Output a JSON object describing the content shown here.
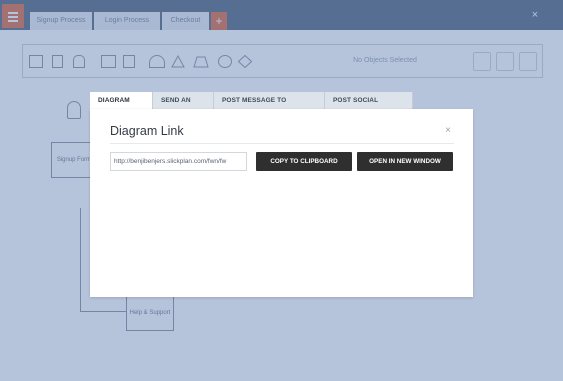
{
  "app": {
    "tabs": [
      "Signup Process",
      "Login Process",
      "Checkout"
    ],
    "add_tab_label": "+",
    "close_label": "×",
    "toolbar_search_label": "No Objects Selected",
    "nodes": {
      "signup_form": "Signup Form",
      "help_support": "Help & Support"
    }
  },
  "modal": {
    "tabs": [
      "DIAGRAM LINK",
      "SEND AN EMAIL",
      "POST MESSAGE TO BASECAMP",
      "POST SOCIAL NETWORKS"
    ],
    "active_tab": 0,
    "title": "Diagram Link",
    "close_label": "×",
    "link_value": "http://benjibenjers.slickplan.com/fwn/fw",
    "copy_button_label": "COPY TO CLIPBOARD",
    "open_button_label": "OPEN IN NEW WINDOW"
  },
  "colors": {
    "overlay": "#5073aa",
    "accent": "#e0704d",
    "button_bg": "#2f2f2f"
  }
}
